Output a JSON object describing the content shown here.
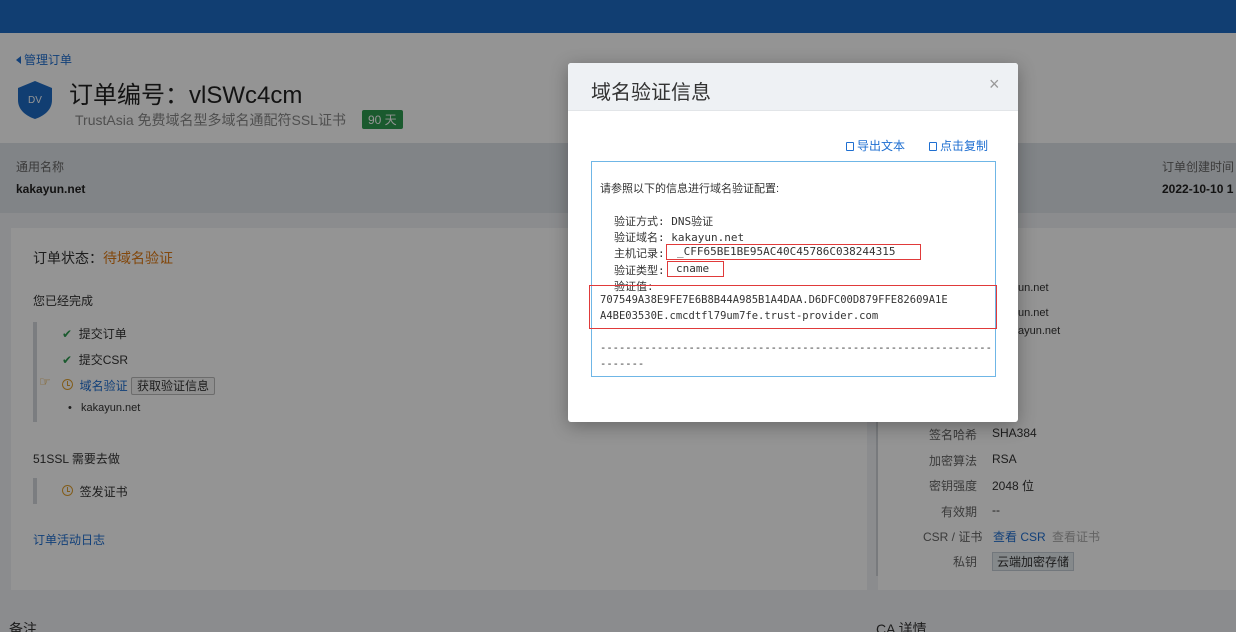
{
  "header": {
    "back_link": "管理订单",
    "badge_text": "DV",
    "order_title": "订单编号：vlSWc4cm",
    "product_subtitle": "TrustAsia 免费域名型多域名通配符SSL证书",
    "days_badge": "90 天"
  },
  "info_strip": {
    "common_name_label": "通用名称",
    "common_name_value": "kakayun.net",
    "created_label": "订单创建时间",
    "created_value": "2022-10-10 1"
  },
  "order": {
    "status_label": "订单状态：",
    "status_value": "待域名验证",
    "completed_heading": "您已经完成",
    "steps": [
      {
        "label": "提交订单"
      },
      {
        "label": "提交CSR"
      },
      {
        "label": "域名验证",
        "button": "获取验证信息"
      }
    ],
    "domain_bullet": "kakayun.net",
    "todo_heading": "51SSL 需要去做",
    "todo_step": "签发证书",
    "activity_log": "订单活动日志"
  },
  "details": {
    "partial_1": "un.net",
    "partial_2": "un.net",
    "partial_3": "ayun.net",
    "rows": [
      {
        "label": "签名哈希",
        "value": "SHA384"
      },
      {
        "label": "加密算法",
        "value": "RSA"
      },
      {
        "label": "密钥强度",
        "value": "2048 位"
      },
      {
        "label": "有效期",
        "value": "--"
      }
    ],
    "csr_label": "CSR / 证书",
    "view_csr": "查看 CSR",
    "view_cert": "查看证书",
    "key_label": "私钥",
    "key_value": "云端加密存储"
  },
  "footer": {
    "notes_heading": "备注",
    "ca_heading": "CA 详情"
  },
  "modal": {
    "title": "域名验证信息",
    "close": "×",
    "export_text": "导出文本",
    "copy_text": "点击复制",
    "intro": "请参照以下的信息进行域名验证配置:",
    "method_line": "验证方式: DNS验证",
    "domain_line": "验证域名: kakayun.net",
    "host_label": "主机记录:",
    "host_value": "_CFF65BE1BE95AC40C45786C038244315",
    "type_label": "验证类型:",
    "type_value": "cname",
    "value_label": "验证值:",
    "value_line1": "707549A38E9FE7E6B8B44A985B1A4DAA.D6DFC00D879FFE82609A1E",
    "value_line2": "A4BE03530E.cmcdtfl79um7fe.trust-provider.com",
    "divider_line1": "--------------------------------------------------------------",
    "divider_line2": "-------"
  }
}
